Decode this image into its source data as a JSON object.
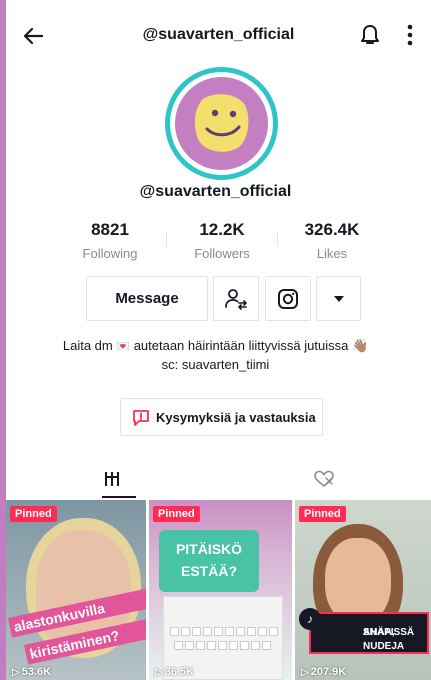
{
  "header": {
    "title": "@suavarten_official",
    "icons": {
      "back": "back-arrow-icon",
      "bell": "bell-icon",
      "more": "more-vertical-icon"
    }
  },
  "profile": {
    "username": "@suavarten_official",
    "avatar": "smiley-face-avatar",
    "avatar_ring_color": "#2ec4c8",
    "avatar_bg_color": "#c47fc2"
  },
  "stats": {
    "following": {
      "value": "8821",
      "label": "Following"
    },
    "followers": {
      "value": "12.2K",
      "label": "Followers"
    },
    "likes": {
      "value": "326.4K",
      "label": "Likes"
    }
  },
  "actions": {
    "message_label": "Message",
    "follow_icon": "follow-user-icon",
    "instagram_icon": "instagram-icon",
    "more_icon": "caret-down-icon"
  },
  "bio": {
    "line1_before": "Laita dm",
    "line1_heart": "💌",
    "line1_after": "autetaan häirintään liittyvissä jutuissa",
    "line1_emoji": "👋🏽",
    "line2": "sc: suavarten_tiimi"
  },
  "qa": {
    "label": "Kysymyksiä ja vastauksia",
    "icon": "question-box-icon"
  },
  "tabs": [
    {
      "icon": "grid-icon",
      "active": true
    },
    {
      "icon": "liked-heart-icon",
      "active": false
    }
  ],
  "videos": [
    {
      "pinned": "Pinned",
      "views": "53.6K",
      "caption1": "alastonkuvilla",
      "caption2": "kiristäminen?"
    },
    {
      "pinned": "Pinned",
      "views": "36.5K",
      "caption1": "PITÄISKÖ",
      "caption2": "ESTÄÄ?"
    },
    {
      "pinned": "Pinned",
      "views": "207.9K",
      "caption1": "AHAA, NUDEJA",
      "caption2": "SNÄPISSÄ"
    }
  ],
  "colors": {
    "accent": "#fe2c55",
    "text": "#161823",
    "muted": "#8a8b91",
    "border": "#e3e3e4"
  }
}
